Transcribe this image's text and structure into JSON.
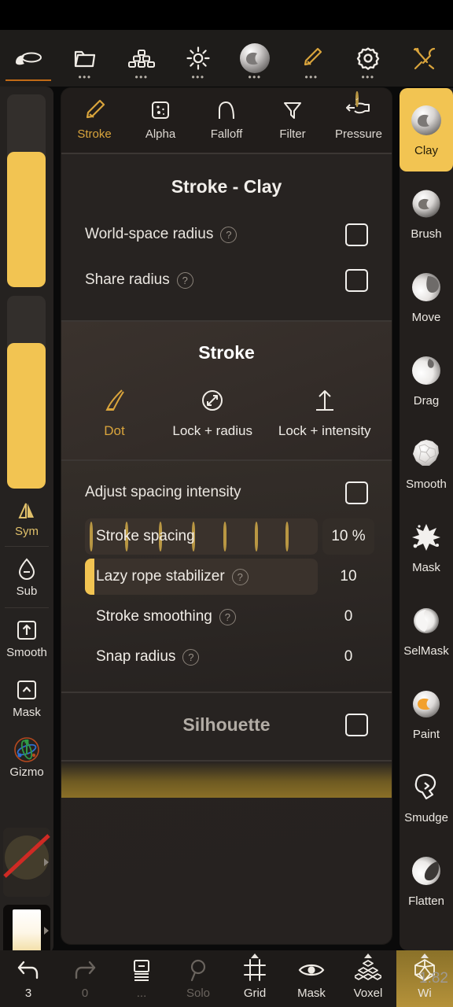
{
  "app": {
    "version": "1.82"
  },
  "topbar": {
    "items": [
      {
        "name": "scene-icon",
        "label": "",
        "dots": "",
        "active": true
      },
      {
        "name": "files-icon",
        "label": "",
        "dots": "•••",
        "active": false
      },
      {
        "name": "layers-icon",
        "label": "",
        "dots": "•••",
        "active": false
      },
      {
        "name": "lighting-icon",
        "label": "",
        "dots": "•••",
        "active": false
      },
      {
        "name": "material-icon",
        "label": "",
        "dots": "•••",
        "active": false
      },
      {
        "name": "brush-icon",
        "label": "",
        "dots": "•••",
        "active": false
      },
      {
        "name": "settings-icon",
        "label": "",
        "dots": "•••",
        "active": false
      },
      {
        "name": "tools-icon",
        "label": "",
        "dots": "",
        "active": false
      }
    ]
  },
  "left_sidebar": {
    "sliders": [
      {
        "name": "radius-slider",
        "value_pct": 70
      },
      {
        "name": "intensity-slider",
        "value_pct": 75
      }
    ],
    "symmetry": {
      "label": "Sym"
    },
    "buttons": [
      {
        "label": "Sub",
        "icon": "droplet-minus-icon"
      },
      {
        "label": "Smooth",
        "icon": "square-up-arrow-icon"
      },
      {
        "label": "Mask",
        "icon": "square-caret-up-icon"
      },
      {
        "label": "Gizmo",
        "icon": "gizmo-icon"
      }
    ],
    "swatches": [
      {
        "name": "alpha-swatch-none"
      },
      {
        "name": "color-swatch"
      }
    ]
  },
  "panel": {
    "tabs": [
      {
        "label": "Stroke",
        "icon": "brush-icon",
        "active": true
      },
      {
        "label": "Alpha",
        "icon": "alpha-icon",
        "active": false
      },
      {
        "label": "Falloff",
        "icon": "falloff-icon",
        "active": false
      },
      {
        "label": "Filter",
        "icon": "funnel-icon",
        "active": false
      },
      {
        "label": "Pressure",
        "icon": "pressure-icon",
        "active": false
      }
    ],
    "header": {
      "title": "Stroke - Clay"
    },
    "header_options": [
      {
        "label": "World-space radius",
        "help": "?",
        "checked": false
      },
      {
        "label": "Share radius",
        "help": "?",
        "checked": false
      }
    ],
    "stroke_section": {
      "title": "Stroke",
      "modes": [
        {
          "label": "Dot",
          "icon": "dot-brush-icon",
          "active": true
        },
        {
          "label": "Lock + radius",
          "icon": "lock-radius-icon",
          "active": false
        },
        {
          "label": "Lock + intensity",
          "icon": "lock-intensity-icon",
          "active": false
        }
      ]
    },
    "spacing_section": {
      "toggle": {
        "label": "Adjust spacing intensity",
        "checked": true
      },
      "sliders": [
        {
          "label": "Stroke spacing",
          "help": null,
          "value": "10 %",
          "fill_pct": 0,
          "ticks": true,
          "boxed": true
        },
        {
          "label": "Lazy rope stabilizer",
          "help": "?",
          "value": "10",
          "fill_pct": 4,
          "ticks": false,
          "boxed": true
        },
        {
          "label": "Stroke smoothing",
          "help": "?",
          "value": "0",
          "fill_pct": 0,
          "ticks": false,
          "boxed": false
        },
        {
          "label": "Snap radius",
          "help": "?",
          "value": "0",
          "fill_pct": 0,
          "ticks": false,
          "boxed": false
        }
      ]
    },
    "silhouette_section": {
      "title": "Silhouette",
      "checked": false
    }
  },
  "right_sidebar": {
    "tools": [
      {
        "label": "Clay",
        "icon": "clay-sphere-icon",
        "active": true
      },
      {
        "label": "Brush",
        "icon": "brush-sphere-icon",
        "active": false
      },
      {
        "label": "Move",
        "icon": "move-sphere-icon",
        "active": false
      },
      {
        "label": "Drag",
        "icon": "drag-sphere-icon",
        "active": false
      },
      {
        "label": "Smooth",
        "icon": "smooth-sphere-icon",
        "active": false
      },
      {
        "label": "Mask",
        "icon": "mask-splat-icon",
        "active": false
      },
      {
        "label": "SelMask",
        "icon": "selmask-sphere-icon",
        "active": false
      },
      {
        "label": "Paint",
        "icon": "paint-sphere-icon",
        "active": false
      },
      {
        "label": "Smudge",
        "icon": "smudge-icon",
        "active": false
      },
      {
        "label": "Flatten",
        "icon": "flatten-sphere-icon",
        "active": false
      }
    ]
  },
  "bottombar": {
    "items": [
      {
        "label": "3",
        "icon": "undo-icon",
        "dim": false,
        "highlight": false,
        "caret": false
      },
      {
        "label": "0",
        "icon": "redo-icon",
        "dim": true,
        "highlight": false,
        "caret": false
      },
      {
        "label": "...",
        "icon": "layers-icon",
        "dim": true,
        "highlight": false,
        "caret": false
      },
      {
        "label": "Solo",
        "icon": "magnifier-icon",
        "dim": true,
        "highlight": false,
        "caret": false
      },
      {
        "label": "Grid",
        "icon": "grid-icon",
        "dim": false,
        "highlight": false,
        "caret": true
      },
      {
        "label": "Mask",
        "icon": "eye-icon",
        "dim": false,
        "highlight": false,
        "caret": false
      },
      {
        "label": "Voxel",
        "icon": "voxel-icon",
        "dim": false,
        "highlight": false,
        "caret": true
      },
      {
        "label": "Wi",
        "icon": "wireframe-icon",
        "dim": false,
        "highlight": true,
        "caret": true
      }
    ]
  },
  "colors": {
    "accent": "#f2c452",
    "accent_text": "#d9a43c",
    "panel_bg": "#2a2522",
    "bar_bg": "#1e1b19"
  }
}
